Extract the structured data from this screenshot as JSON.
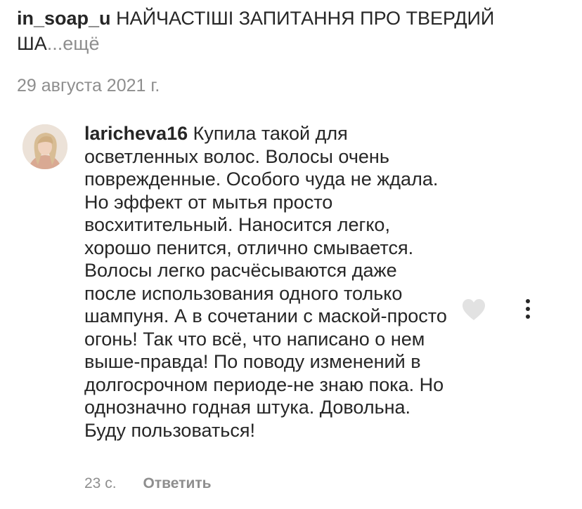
{
  "post": {
    "username": "in_soap_u",
    "caption_text": "НАЙЧАСТІШІ ЗАПИТАННЯ ПРО ТВЕРДИЙ ША",
    "more_label": "...ещё",
    "date": "29 августа 2021 г."
  },
  "comment": {
    "username": "laricheva16",
    "text": "Купила такой для осветленных волос. Волосы очень поврежденные. Особого чуда не ждала. Но эффект от мытья просто восхитительный. Наносится легко, хорошо пенится, отлично смывается. Волосы легко расчёсываются даже после использования одного только шампуня. А в сочетании с маской-просто огонь! Так что всё, что написано о нем выше-правда! По поводу изменений в долгосрочном периоде-не знаю пока. Но однозначно годная штука. Довольна. Буду пользоваться!",
    "time": "23 с.",
    "reply_label": "Ответить",
    "avatar_icon": "user-avatar",
    "like_icon": "heart-outline-icon",
    "options_icon": "more-vertical-icon"
  }
}
